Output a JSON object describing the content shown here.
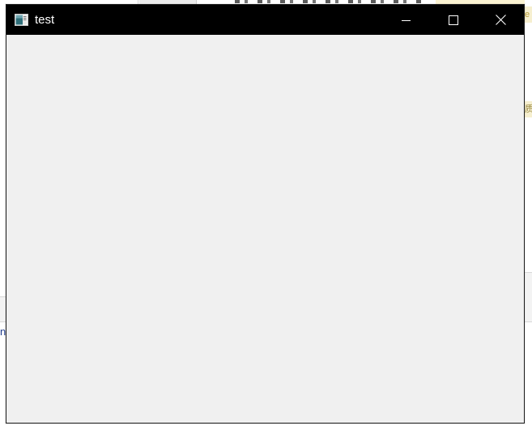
{
  "window": {
    "title": "test",
    "icon": "app-window-icon",
    "controls": {
      "minimize_icon": "minimize-icon",
      "maximize_icon": "maximize-icon",
      "close_icon": "close-icon"
    },
    "colors": {
      "titlebar": "#000000",
      "title_text": "#ffffff",
      "client_background": "#f0f0f0",
      "border": "#1a1a1a"
    }
  },
  "background": {
    "right_hint_1": "e",
    "right_hint_2": "质",
    "left_char": "n"
  }
}
